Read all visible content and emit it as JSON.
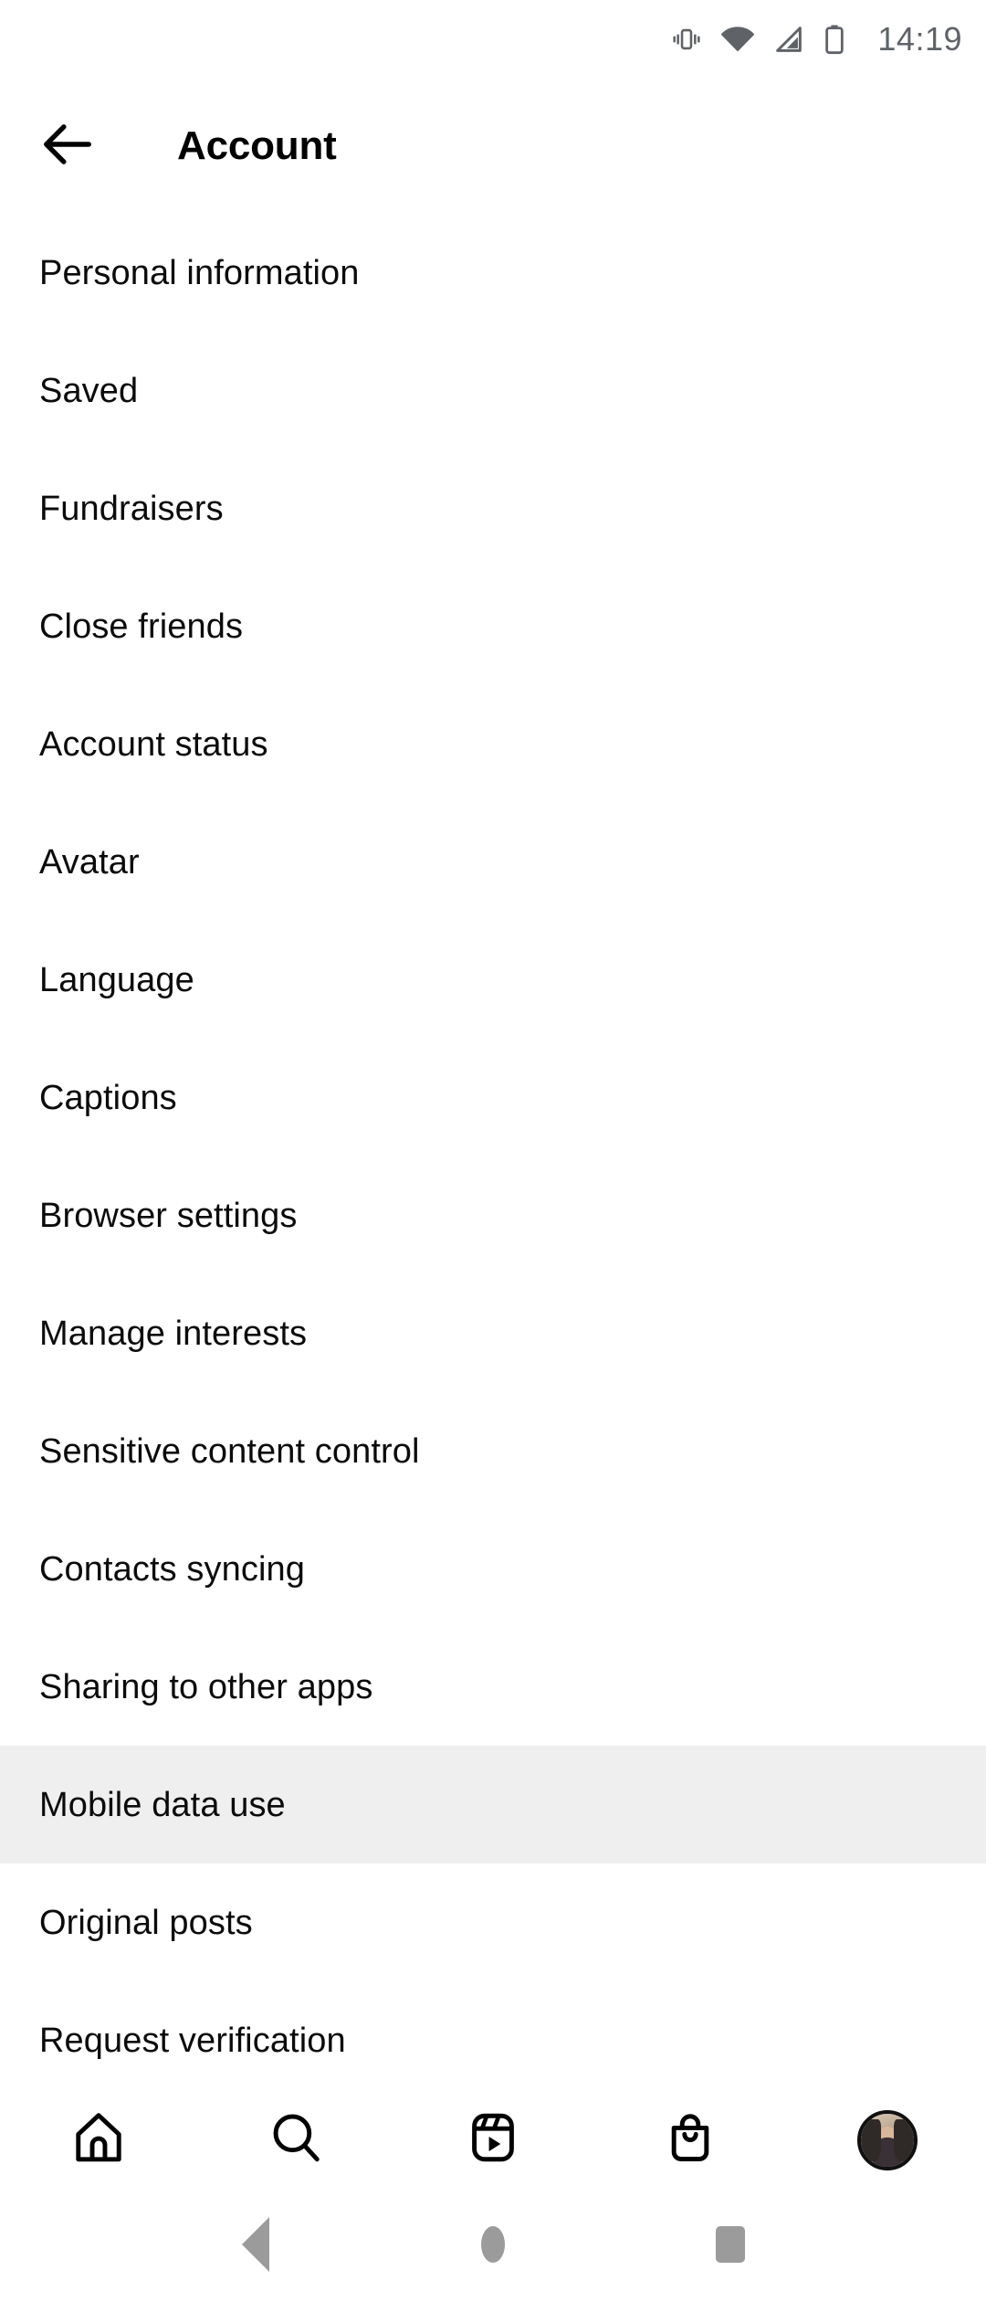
{
  "status_bar": {
    "time": "14:19",
    "icons": [
      "vibrate-icon",
      "wifi-icon",
      "cellular-signal-icon",
      "battery-icon"
    ]
  },
  "header": {
    "back_icon": "arrow-left-icon",
    "title": "Account"
  },
  "settings": {
    "items": [
      {
        "label": "Personal information",
        "highlighted": false
      },
      {
        "label": "Saved",
        "highlighted": false
      },
      {
        "label": "Fundraisers",
        "highlighted": false
      },
      {
        "label": "Close friends",
        "highlighted": false
      },
      {
        "label": "Account status",
        "highlighted": false
      },
      {
        "label": "Avatar",
        "highlighted": false
      },
      {
        "label": "Language",
        "highlighted": false
      },
      {
        "label": "Captions",
        "highlighted": false
      },
      {
        "label": "Browser settings",
        "highlighted": false
      },
      {
        "label": "Manage interests",
        "highlighted": false
      },
      {
        "label": "Sensitive content control",
        "highlighted": false
      },
      {
        "label": "Contacts syncing",
        "highlighted": false
      },
      {
        "label": "Sharing to other apps",
        "highlighted": false
      },
      {
        "label": "Mobile data use",
        "highlighted": true
      },
      {
        "label": "Original posts",
        "highlighted": false
      },
      {
        "label": "Request verification",
        "highlighted": false
      }
    ]
  },
  "tab_bar": {
    "tabs": [
      {
        "name": "home-icon",
        "label": "Home"
      },
      {
        "name": "search-icon",
        "label": "Search"
      },
      {
        "name": "reels-icon",
        "label": "Reels"
      },
      {
        "name": "shop-icon",
        "label": "Shop"
      },
      {
        "name": "profile-avatar",
        "label": "Profile"
      }
    ]
  },
  "system_nav": {
    "buttons": [
      {
        "name": "android-back-button",
        "label": "Back"
      },
      {
        "name": "android-home-button",
        "label": "Home"
      },
      {
        "name": "android-recents-button",
        "label": "Recents"
      }
    ]
  },
  "colors": {
    "background": "#ffffff",
    "text": "#0b0b0b",
    "highlight_row": "#efefef",
    "status_text": "#5f6368",
    "system_nav_icon": "#9b9b9b"
  }
}
